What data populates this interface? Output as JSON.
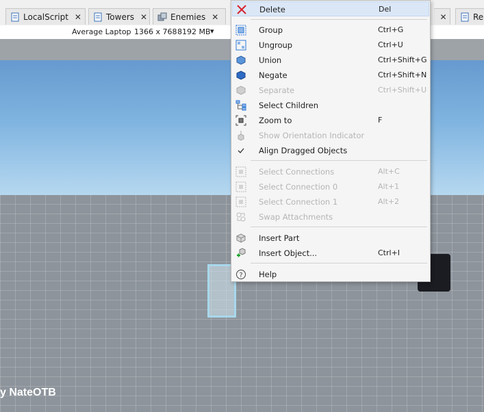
{
  "tabs": [
    {
      "label": "LocalScript",
      "icon": "script-icon"
    },
    {
      "label": "Towers",
      "icon": "script-icon"
    },
    {
      "label": "Enemies",
      "icon": "model-icon"
    },
    {
      "label": "Re",
      "icon": "script-icon"
    }
  ],
  "device": {
    "name": "Average Laptop",
    "resolution": "1366 x 768",
    "memory": "8192 MB"
  },
  "viewport": {
    "credit": "y NateOTB"
  },
  "menu": {
    "delete": {
      "label": "Delete",
      "shortcut": "Del"
    },
    "group": {
      "label": "Group",
      "shortcut": "Ctrl+G"
    },
    "ungroup": {
      "label": "Ungroup",
      "shortcut": "Ctrl+U"
    },
    "union": {
      "label": "Union",
      "shortcut": "Ctrl+Shift+G"
    },
    "negate": {
      "label": "Negate",
      "shortcut": "Ctrl+Shift+N"
    },
    "separate": {
      "label": "Separate",
      "shortcut": "Ctrl+Shift+U"
    },
    "select_children": {
      "label": "Select Children",
      "shortcut": ""
    },
    "zoom_to": {
      "label": "Zoom to",
      "shortcut": "F"
    },
    "show_orientation": {
      "label": "Show Orientation Indicator",
      "shortcut": ""
    },
    "align_dragged": {
      "label": "Align Dragged Objects",
      "shortcut": ""
    },
    "select_connections": {
      "label": "Select Connections",
      "shortcut": "Alt+C"
    },
    "select_connection_0": {
      "label": "Select Connection 0",
      "shortcut": "Alt+1"
    },
    "select_connection_1": {
      "label": "Select Connection 1",
      "shortcut": "Alt+2"
    },
    "swap_attachments": {
      "label": "Swap Attachments",
      "shortcut": ""
    },
    "insert_part": {
      "label": "Insert Part",
      "shortcut": ""
    },
    "insert_object": {
      "label": "Insert Object...",
      "shortcut": "Ctrl+I"
    },
    "help": {
      "label": "Help",
      "shortcut": ""
    }
  },
  "colors": {
    "highlight": "#dbe7f6",
    "disabled_text": "#b5b5b5",
    "delete_red": "#d9232e",
    "accent_blue": "#2f7bd9"
  }
}
